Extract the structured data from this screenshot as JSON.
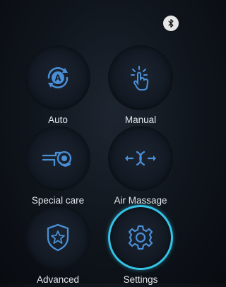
{
  "status": {
    "bluetooth_icon": "bluetooth-icon"
  },
  "menu": {
    "items": [
      {
        "label": "Auto",
        "icon": "auto-mode-icon"
      },
      {
        "label": "Manual",
        "icon": "manual-touch-icon"
      },
      {
        "label": "Special care",
        "icon": "special-care-icon"
      },
      {
        "label": "Air Massage",
        "icon": "air-massage-icon"
      },
      {
        "label": "Advanced",
        "icon": "advanced-shield-icon"
      },
      {
        "label": "Settings",
        "icon": "settings-gear-icon",
        "selected": true
      }
    ]
  },
  "colors": {
    "accent": "#34c3e6",
    "icon": "#4a8fd6",
    "label": "#e4e7eb"
  }
}
